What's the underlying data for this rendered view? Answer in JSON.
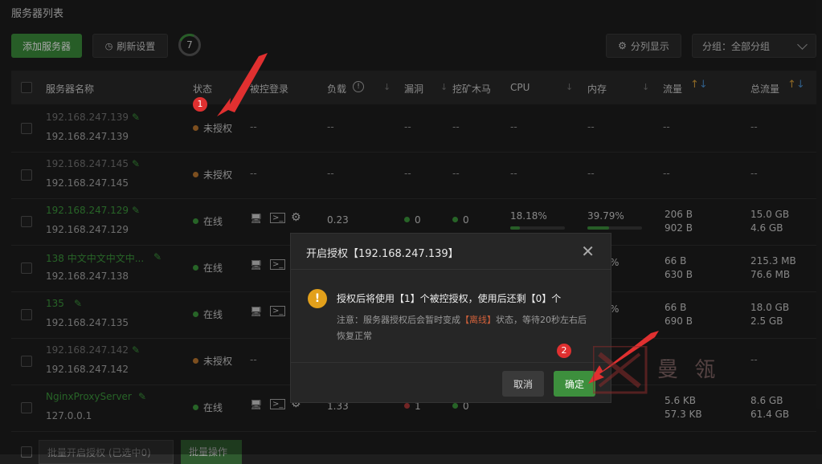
{
  "page_title": "服务器列表",
  "toolbar": {
    "add_label": "添加服务器",
    "refresh_label": "刷新设置",
    "count": "7",
    "column_label": "分列显示",
    "group_label": "分组：全部分组"
  },
  "table": {
    "headers": {
      "name": "服务器名称",
      "status": "状态",
      "control": "被控登录",
      "load": "负载",
      "vuln": "漏洞",
      "miner": "挖矿木马",
      "cpu": "CPU",
      "mem": "内存",
      "traffic": "流量",
      "total": "总流量"
    },
    "dash": "--",
    "rows": [
      {
        "ip1": "192.168.247.139",
        "ip2": "192.168.247.139",
        "status": "未授权"
      },
      {
        "ip1": "192.168.247.145",
        "ip2": "192.168.247.145",
        "status": "未授权"
      },
      {
        "ip1": "192.168.247.129",
        "ip2": "192.168.247.129",
        "status": "在线",
        "load": "0.23",
        "vuln": "0",
        "miner": "0",
        "cpu": "18.18%",
        "cpu_pct": 18.18,
        "mem": "39.79%",
        "mem_pct": 39.79,
        "t1": "206 B",
        "t2": "902 B",
        "tt1": "15.0 GB",
        "tt2": "4.6 GB"
      },
      {
        "ip1": "138 中文中文中文中...",
        "ip2": "192.168.247.138",
        "status": "在线",
        "mem": "%",
        "t1": "66 B",
        "t2": "630 B",
        "tt1": "215.3 MB",
        "tt2": "76.6 MB"
      },
      {
        "ip1": "135",
        "ip2": "192.168.247.135",
        "status": "在线",
        "mem": "%",
        "t1": "66 B",
        "t2": "690 B",
        "tt1": "18.0 GB",
        "tt2": "2.5 GB"
      },
      {
        "ip1": "192.168.247.142",
        "ip2": "192.168.247.142",
        "status": "未授权"
      },
      {
        "ip1": "NginxProxyServer",
        "ip2": "127.0.0.1",
        "status": "在线",
        "load": "1.33",
        "vuln": "1",
        "miner": "0",
        "t1": "5.6 KB",
        "t2": "57.3 KB",
        "tt1": "8.6 GB",
        "tt2": "61.4 GB"
      }
    ]
  },
  "modal": {
    "title": "开启授权【192.168.247.139】",
    "message": "授权后将使用【1】个被控授权，使用后还剩【0】个",
    "note_a": "注意：服务器授权后会暂时变成",
    "note_red": "【离线】",
    "note_b": "状态，等待20秒左右后恢复正常",
    "cancel": "取消",
    "confirm": "确定"
  },
  "badges": {
    "one": "1",
    "two": "2"
  },
  "bottom": {
    "batch_auth": "批量开启授权 (已选中0)",
    "batch_op": "批量操作"
  },
  "colors": {
    "accent": "#3d8f3d",
    "background": "#1e1e1e",
    "warning": "#e2a01b",
    "badge": "#e03030"
  }
}
